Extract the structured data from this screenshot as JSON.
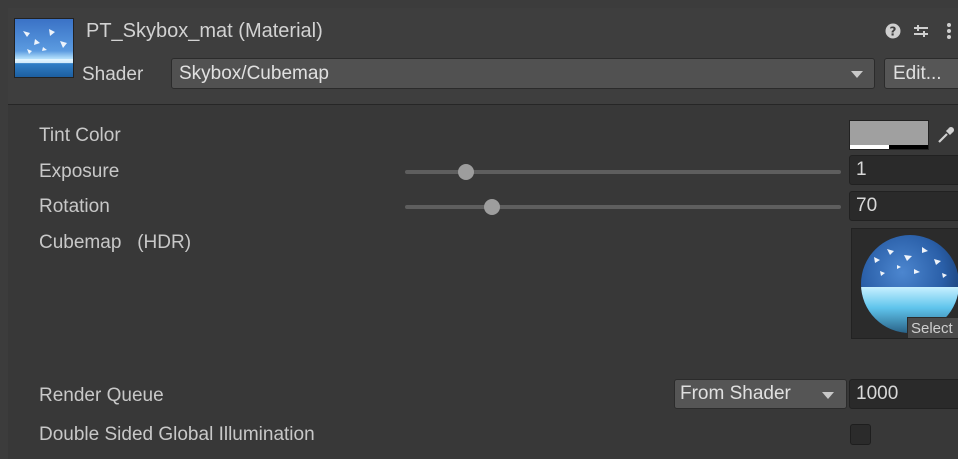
{
  "material": {
    "title": "PT_Skybox_mat (Material)",
    "thumbnail_icon": "skybox-material-icon",
    "header_icons": [
      "help-icon",
      "preset-icon",
      "kebab-menu-icon"
    ]
  },
  "shader": {
    "label": "Shader",
    "value": "Skybox/Cubemap",
    "edit_label": "Edit..."
  },
  "properties": {
    "tint_color": {
      "label": "Tint Color",
      "color": "#a0a0a0",
      "alpha_white_fraction": 0.5,
      "icon": "eyedropper-icon"
    },
    "exposure": {
      "label": "Exposure",
      "value": "1",
      "slider_fraction": 0.14
    },
    "rotation": {
      "label": "Rotation",
      "value": "70",
      "slider_fraction": 0.2
    },
    "cubemap": {
      "label": "Cubemap",
      "hdr_label": "(HDR)",
      "select_label": "Select"
    }
  },
  "render_queue": {
    "label": "Render Queue",
    "mode": "From Shader",
    "value": "1000"
  },
  "double_sided_gi": {
    "label": "Double Sided Global Illumination",
    "checked": false
  }
}
